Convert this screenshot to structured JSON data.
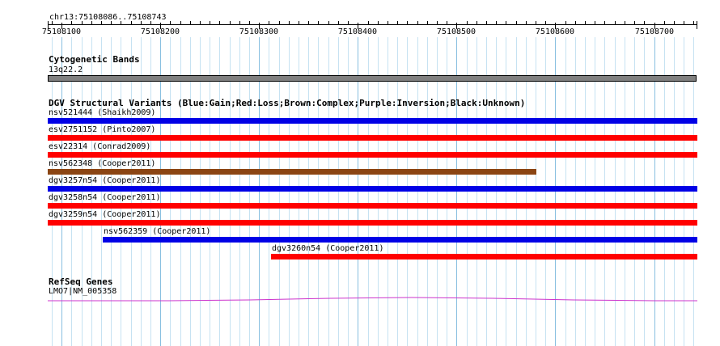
{
  "locus": "chr13:75108086..75108743",
  "ruler": {
    "labels": [
      "75108100",
      "75108200",
      "75108300",
      "75108400",
      "75108500",
      "75108600",
      "75108700"
    ]
  },
  "tracks": {
    "cytoband": {
      "title": "Cytogenetic Bands",
      "band": "13q22.2"
    },
    "dgv": {
      "title": "DGV Structural Variants (Blue:Gain;Red:Loss;Brown:Complex;Purple:Inversion;Black:Unknown)",
      "features": [
        {
          "label": "nsv521444 (Shaikh2009)",
          "color": "#0000e6"
        },
        {
          "label": "esv2751152 (Pinto2007)",
          "color": "#ff0000"
        },
        {
          "label": "esv22314 (Conrad2009)",
          "color": "#ff0000"
        },
        {
          "label": "nsv562348 (Cooper2011)",
          "color": "#8b4513"
        },
        {
          "label": "dgv3257n54 (Cooper2011)",
          "color": "#0000e6"
        },
        {
          "label": "dgv3258n54 (Cooper2011)",
          "color": "#ff0000"
        },
        {
          "label": "dgv3259n54 (Cooper2011)",
          "color": "#ff0000"
        },
        {
          "label": "nsv562359 (Cooper2011)",
          "color": "#0000e6"
        },
        {
          "label": "dgv3260n54 (Cooper2011)",
          "color": "#ff0000"
        }
      ]
    },
    "refseq": {
      "title": "RefSeq Genes",
      "gene": "LMO7|NM_005358",
      "color": "#cc33cc"
    }
  }
}
